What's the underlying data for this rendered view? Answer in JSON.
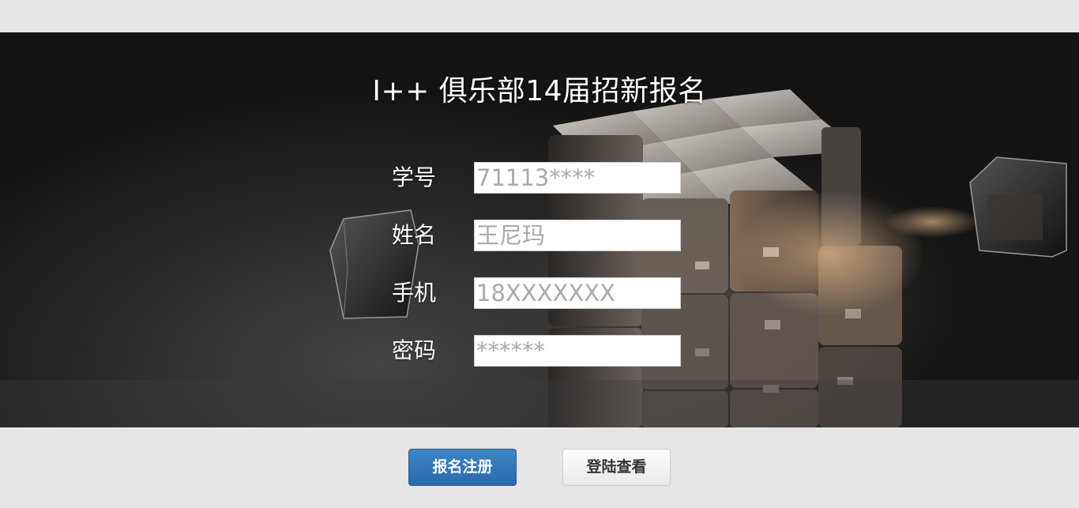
{
  "page": {
    "title": "I++ 俱乐部14届招新报名"
  },
  "form": {
    "student_id": {
      "label": "学号",
      "placeholder": "71113****"
    },
    "name": {
      "label": "姓名",
      "placeholder": "王尼玛"
    },
    "phone": {
      "label": "手机",
      "placeholder": "18XXXXXXX"
    },
    "password": {
      "label": "密码",
      "placeholder": "******"
    }
  },
  "actions": {
    "register_label": "报名注册",
    "login_label": "登陆查看"
  },
  "colors": {
    "primary_button": "#2f74b8",
    "page_background": "#e6e6e6",
    "hero_background": "#1a1a1a"
  }
}
